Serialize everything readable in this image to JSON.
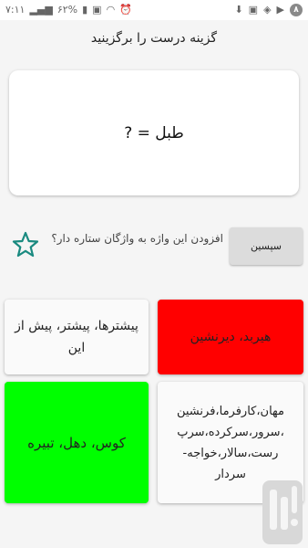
{
  "status_bar": {
    "time": "۷:۱۱",
    "battery": "۶۲%",
    "notification_count": "۸"
  },
  "header": {
    "title": "گزینه درست را برگزینید"
  },
  "question": {
    "text": "طبل = ?"
  },
  "favorite": {
    "prompt": "افزودن این واژه به واژگان ستاره دار؟",
    "thanks_label": "سپسین",
    "star_color": "#1a8a80"
  },
  "options": [
    {
      "text": "پیشترها، پیشتر، پیش از این",
      "color": "#fafafa"
    },
    {
      "text": "هیربد، دیرنشین",
      "color": "#ff0000"
    },
    {
      "text": "کوس، دهل، تبیره",
      "color": "#00ff00"
    },
    {
      "text": "مهان،کارفرما،فرنشین ،سرور،سرکرده،سرپ رست،سالار،خواجه- سردار",
      "color": "#fafafa"
    }
  ]
}
